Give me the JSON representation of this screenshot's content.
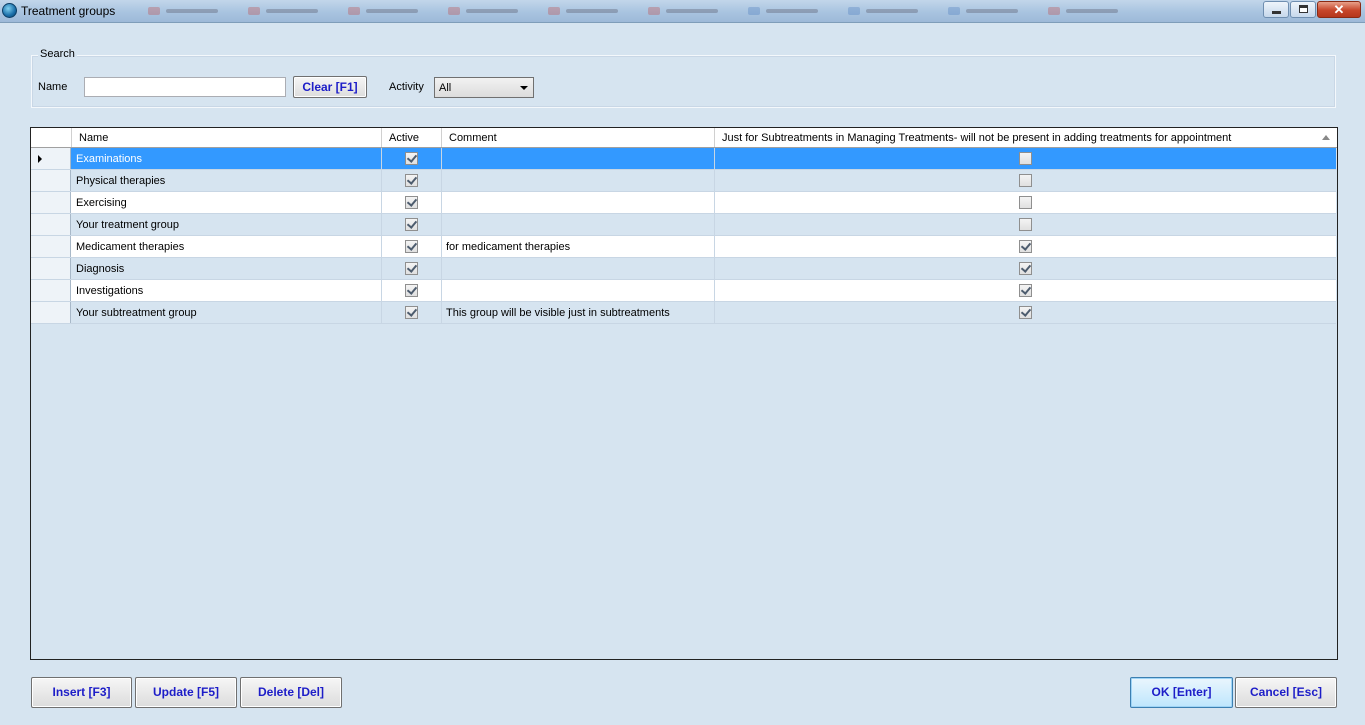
{
  "window": {
    "title": "Treatment groups",
    "close_glyph": "✕"
  },
  "search": {
    "legend": "Search",
    "name_label": "Name",
    "name_value": "",
    "name_placeholder": "",
    "clear_label": "Clear [F1]",
    "activity_label": "Activity",
    "activity_value": "All"
  },
  "grid": {
    "columns": {
      "name": "Name",
      "active": "Active",
      "comment": "Comment",
      "subonly": "Just for Subtreatments in Managing Treatments- will not be present in adding treatments for appointment"
    },
    "rows": [
      {
        "name": "Examinations",
        "active": true,
        "comment": "",
        "subonly": false
      },
      {
        "name": "Physical therapies",
        "active": true,
        "comment": "",
        "subonly": false
      },
      {
        "name": "Exercising",
        "active": true,
        "comment": "",
        "subonly": false
      },
      {
        "name": "Your treatment group",
        "active": true,
        "comment": "",
        "subonly": false
      },
      {
        "name": "Medicament therapies",
        "active": true,
        "comment": "for medicament therapies",
        "subonly": true
      },
      {
        "name": "Diagnosis",
        "active": true,
        "comment": "",
        "subonly": true
      },
      {
        "name": "Investigations",
        "active": true,
        "comment": "",
        "subonly": true
      },
      {
        "name": "Your subtreatment group",
        "active": true,
        "comment": "This group will be visible just in subtreatments",
        "subonly": true
      }
    ],
    "selected_row": 0
  },
  "buttons": {
    "insert": "Insert [F3]",
    "update": "Update [F5]",
    "delete": "Delete [Del]",
    "ok": "OK [Enter]",
    "cancel": "Cancel [Esc]"
  },
  "colors": {
    "background": "#d6e4f0",
    "selection": "#3399ff",
    "button_text": "#1d1dc8"
  }
}
